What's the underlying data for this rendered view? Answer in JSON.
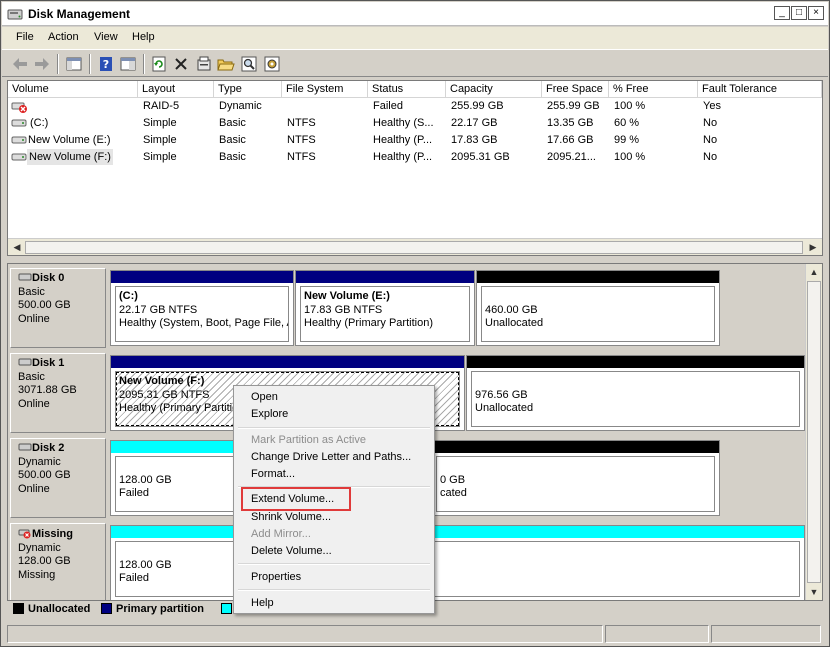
{
  "window": {
    "title": "Disk Management"
  },
  "caption_buttons": {
    "minimize": "_",
    "maximize": "□",
    "close": "×"
  },
  "menu": [
    "File",
    "Action",
    "View",
    "Help"
  ],
  "toolbar": {
    "buttons": [
      "back-arrow-icon",
      "forward-arrow-icon",
      "show-hide-console-tree-icon",
      "help-icon",
      "properties-pane-icon",
      "refresh-icon",
      "delete-icon",
      "properties-icon",
      "open-folder-icon",
      "search-icon",
      "settings-icon"
    ]
  },
  "volume_table": {
    "columns": [
      "Volume",
      "Layout",
      "Type",
      "File System",
      "Status",
      "Capacity",
      "Free Space",
      "% Free",
      "Fault Tolerance"
    ],
    "rows": [
      {
        "volume": "",
        "layout": "RAID-5",
        "type": "Dynamic",
        "fs": "",
        "status": "Failed",
        "capacity": "255.99 GB",
        "free": "255.99 GB",
        "pct": "100 %",
        "ft": "Yes",
        "icon": "error-drive-icon"
      },
      {
        "volume": "(C:)",
        "layout": "Simple",
        "type": "Basic",
        "fs": "NTFS",
        "status": "Healthy (S...",
        "capacity": "22.17 GB",
        "free": "13.35 GB",
        "pct": "60 %",
        "ft": "No",
        "icon": "drive-icon"
      },
      {
        "volume": "New Volume (E:)",
        "layout": "Simple",
        "type": "Basic",
        "fs": "NTFS",
        "status": "Healthy (P...",
        "capacity": "17.83 GB",
        "free": "17.66 GB",
        "pct": "99 %",
        "ft": "No",
        "icon": "drive-icon"
      },
      {
        "volume": "New Volume (F:)",
        "layout": "Simple",
        "type": "Basic",
        "fs": "NTFS",
        "status": "Healthy (P...",
        "capacity": "2095.31 GB",
        "free": "2095.21...",
        "pct": "100 %",
        "ft": "No",
        "icon": "drive-icon"
      }
    ]
  },
  "disks": [
    {
      "name": "Disk 0",
      "type": "Basic",
      "size": "500.00 GB",
      "state": "Online",
      "partitions": [
        {
          "title": "(C:)",
          "line1": "22.17 GB NTFS",
          "line2": "Healthy (System, Boot, Page File, A",
          "bar": "primary"
        },
        {
          "title": "New Volume  (E:)",
          "line1": "17.83 GB NTFS",
          "line2": "Healthy (Primary Partition)",
          "bar": "primary"
        },
        {
          "title": "",
          "line1": "460.00 GB",
          "line2": "Unallocated",
          "bar": "black"
        }
      ]
    },
    {
      "name": "Disk 1",
      "type": "Basic",
      "size": "3071.88 GB",
      "state": "Online",
      "partitions": [
        {
          "title": "New Volume  (F:)",
          "line1": "2095.31 GB NTFS",
          "line2": "Healthy (Primary Partitio",
          "bar": "primary"
        },
        {
          "title": "",
          "line1": "976.56 GB",
          "line2": "Unallocated",
          "bar": "black"
        }
      ]
    },
    {
      "name": "Disk 2",
      "type": "Dynamic",
      "size": "500.00 GB",
      "state": "Online",
      "partitions": [
        {
          "title": "",
          "line1": "128.00 GB",
          "line2": "Failed",
          "bar": "cyan"
        },
        {
          "title": "",
          "line1": "0 GB",
          "line2": "cated",
          "bar": "black"
        }
      ]
    },
    {
      "name": "Missing",
      "type": "Dynamic",
      "size": "128.00 GB",
      "state": "Missing",
      "partitions": [
        {
          "title": "",
          "line1": "128.00 GB",
          "line2": "Failed",
          "bar": "cyan"
        }
      ]
    }
  ],
  "legend": [
    {
      "label": "Unallocated",
      "color": "#000000"
    },
    {
      "label": "Primary partition",
      "color": "#000080"
    },
    {
      "label": "",
      "color": "#00ffff"
    }
  ],
  "context_menu": {
    "items": [
      {
        "label": "Open",
        "enabled": true
      },
      {
        "label": "Explore",
        "enabled": true
      },
      {
        "label": "Mark Partition as Active",
        "enabled": false
      },
      {
        "label": "Change Drive Letter and Paths...",
        "enabled": true
      },
      {
        "label": "Format...",
        "enabled": true
      },
      {
        "label": "Extend Volume...",
        "enabled": true,
        "highlighted": true
      },
      {
        "label": "Shrink Volume...",
        "enabled": true
      },
      {
        "label": "Add Mirror...",
        "enabled": false
      },
      {
        "label": "Delete Volume...",
        "enabled": true
      },
      {
        "label": "Properties",
        "enabled": true
      },
      {
        "label": "Help",
        "enabled": true
      }
    ]
  },
  "colors": {
    "primary": "#000080",
    "unallocated": "#000000",
    "raid": "#00ffff",
    "highlight": "#e03a3a"
  }
}
